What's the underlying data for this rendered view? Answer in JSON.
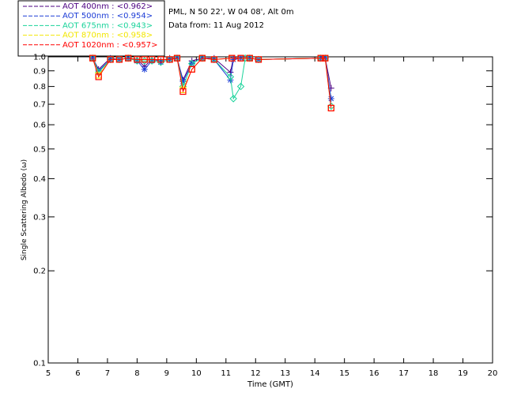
{
  "chart_data": {
    "type": "line",
    "info_lines": [
      "PML, N 50 22', W 04 08', Alt 0m",
      "Data from: 11 Aug 2012"
    ],
    "xlabel": "Time (GMT)",
    "ylabel": "Single Scattering Albedo (ω)",
    "xlim": [
      5,
      20
    ],
    "ylim": [
      0.1,
      1.0
    ],
    "yscale": "log",
    "xticks": [
      5,
      6,
      7,
      8,
      9,
      10,
      11,
      12,
      13,
      14,
      15,
      16,
      17,
      18,
      19,
      20
    ],
    "yticks": [
      0.1,
      0.2,
      0.3,
      0.4,
      0.5,
      0.6,
      0.7,
      0.8,
      0.9,
      1.0
    ],
    "ytick_labels": [
      "0.1",
      "0.2",
      "0.3",
      "0.4",
      "0.5",
      "0.6",
      "0.7",
      "0.8",
      "0.9",
      "1.0"
    ],
    "grid": false,
    "legend_position": "top-left-outside",
    "series": [
      {
        "name": "AOT  400nm : <0.962>",
        "color": "#4b0082",
        "marker": "plus",
        "points": [
          [
            6.5,
            0.99
          ],
          [
            6.7,
            0.91
          ],
          [
            7.1,
            0.99
          ],
          [
            7.4,
            0.98
          ],
          [
            7.7,
            0.99
          ],
          [
            8.0,
            0.98
          ],
          [
            8.25,
            0.93
          ],
          [
            8.5,
            0.98
          ],
          [
            8.8,
            0.97
          ],
          [
            9.1,
            0.99
          ],
          [
            9.35,
            0.99
          ],
          [
            9.55,
            0.84
          ],
          [
            9.85,
            0.97
          ],
          [
            10.2,
            0.99
          ],
          [
            10.6,
            0.99
          ],
          [
            11.15,
            0.89
          ],
          [
            11.25,
            0.99
          ],
          [
            11.5,
            0.99
          ],
          [
            11.8,
            0.99
          ],
          [
            12.1,
            0.98
          ],
          [
            14.2,
            0.99
          ],
          [
            14.35,
            0.99
          ],
          [
            14.55,
            0.79
          ]
        ]
      },
      {
        "name": "AOT  500nm : <0.954>",
        "color": "#1c3cd6",
        "marker": "star",
        "points": [
          [
            6.5,
            0.99
          ],
          [
            6.7,
            0.9
          ],
          [
            7.1,
            0.98
          ],
          [
            7.4,
            0.98
          ],
          [
            7.7,
            0.99
          ],
          [
            8.0,
            0.97
          ],
          [
            8.25,
            0.91
          ],
          [
            8.5,
            0.97
          ],
          [
            8.8,
            0.96
          ],
          [
            9.1,
            0.98
          ],
          [
            9.35,
            0.99
          ],
          [
            9.55,
            0.83
          ],
          [
            9.85,
            0.95
          ],
          [
            10.2,
            0.99
          ],
          [
            10.6,
            0.98
          ],
          [
            11.15,
            0.84
          ],
          [
            11.25,
            0.98
          ],
          [
            11.5,
            0.99
          ],
          [
            11.8,
            0.99
          ],
          [
            12.1,
            0.98
          ],
          [
            14.2,
            0.99
          ],
          [
            14.35,
            0.99
          ],
          [
            14.55,
            0.73
          ]
        ]
      },
      {
        "name": "AOT  675nm : <0.943>",
        "color": "#19d39a",
        "marker": "diamond",
        "points": [
          [
            6.5,
            0.99
          ],
          [
            6.7,
            0.89
          ],
          [
            7.1,
            0.98
          ],
          [
            7.4,
            0.98
          ],
          [
            7.7,
            0.99
          ],
          [
            8.0,
            0.97
          ],
          [
            8.25,
            0.97
          ],
          [
            8.5,
            0.97
          ],
          [
            8.8,
            0.96
          ],
          [
            9.1,
            0.98
          ],
          [
            9.35,
            0.99
          ],
          [
            9.55,
            0.8
          ],
          [
            9.85,
            0.95
          ],
          [
            10.2,
            0.99
          ],
          [
            10.6,
            0.98
          ],
          [
            11.15,
            0.86
          ],
          [
            11.25,
            0.73
          ],
          [
            11.5,
            0.8
          ],
          [
            11.65,
            0.99
          ],
          [
            11.8,
            0.99
          ],
          [
            12.1,
            0.98
          ],
          [
            14.2,
            0.99
          ],
          [
            14.35,
            0.99
          ],
          [
            14.55,
            0.69
          ]
        ]
      },
      {
        "name": "AOT  870nm : <0.958>",
        "color": "#f2e600",
        "marker": "square",
        "points": [
          [
            6.5,
            0.99
          ],
          [
            6.7,
            0.87
          ],
          [
            7.1,
            0.98
          ],
          [
            7.4,
            0.98
          ],
          [
            7.7,
            0.99
          ],
          [
            8.0,
            0.98
          ],
          [
            8.25,
            0.98
          ],
          [
            8.5,
            0.98
          ],
          [
            8.8,
            0.98
          ],
          [
            9.1,
            0.98
          ],
          [
            9.35,
            0.99
          ],
          [
            9.55,
            0.78
          ],
          [
            9.85,
            0.91
          ],
          [
            10.2,
            0.99
          ],
          [
            10.6,
            0.98
          ],
          [
            11.2,
            0.99
          ],
          [
            11.5,
            0.99
          ],
          [
            11.8,
            0.99
          ],
          [
            12.1,
            0.98
          ],
          [
            14.2,
            0.99
          ],
          [
            14.35,
            0.99
          ],
          [
            14.55,
            0.68
          ]
        ]
      },
      {
        "name": "AOT 1020nm : <0.957>",
        "color": "#ff0000",
        "marker": "square",
        "points": [
          [
            6.5,
            0.99
          ],
          [
            6.7,
            0.86
          ],
          [
            7.1,
            0.98
          ],
          [
            7.4,
            0.98
          ],
          [
            7.7,
            0.99
          ],
          [
            8.0,
            0.98
          ],
          [
            8.25,
            0.98
          ],
          [
            8.5,
            0.98
          ],
          [
            8.8,
            0.98
          ],
          [
            9.1,
            0.98
          ],
          [
            9.35,
            0.99
          ],
          [
            9.55,
            0.77
          ],
          [
            9.85,
            0.91
          ],
          [
            10.2,
            0.99
          ],
          [
            10.6,
            0.98
          ],
          [
            11.2,
            0.99
          ],
          [
            11.5,
            0.99
          ],
          [
            11.8,
            0.99
          ],
          [
            12.1,
            0.98
          ],
          [
            14.2,
            0.99
          ],
          [
            14.35,
            0.99
          ],
          [
            14.55,
            0.68
          ]
        ]
      }
    ]
  }
}
